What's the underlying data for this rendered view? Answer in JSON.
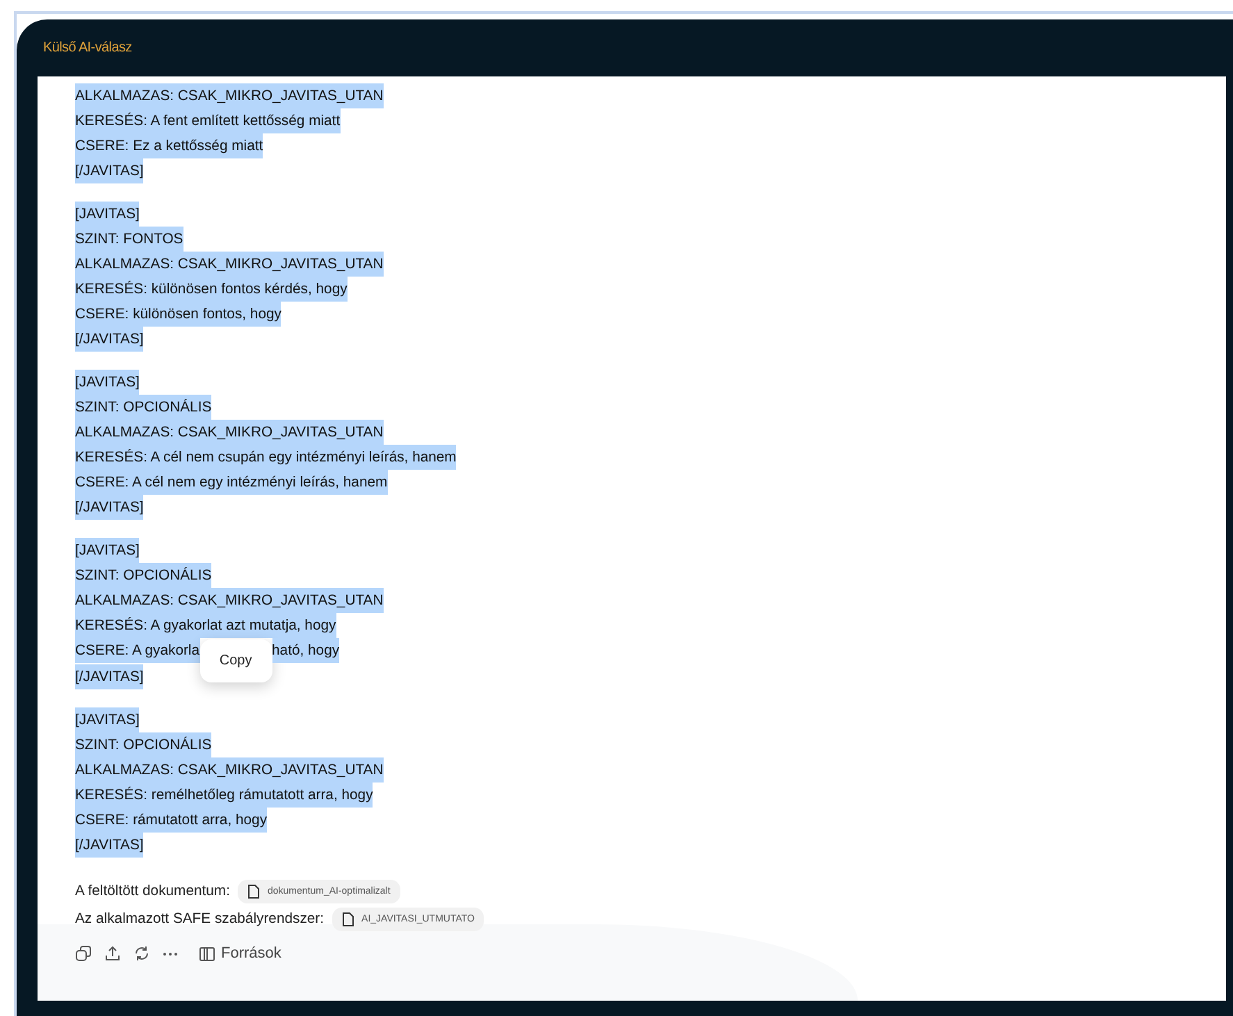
{
  "window": {
    "title": "Külső AI-válasz"
  },
  "blocks": [
    {
      "highlighted": true,
      "lines": [
        {
          "kind": "text",
          "text": "ALKALMAZAS: CSAK_MIKRO_JAVITAS_UTAN"
        },
        {
          "kind": "text",
          "text": "KERESÉS: A fent említett kettősség miatt"
        },
        {
          "kind": "text",
          "text": "CSERE: Ez a kettősség miatt"
        },
        {
          "kind": "text",
          "text": "[/JAVITAS]"
        }
      ]
    },
    {
      "highlighted": true,
      "lines": [
        {
          "kind": "text",
          "text": "[JAVITAS]"
        },
        {
          "kind": "text",
          "text": "SZINT: FONTOS"
        },
        {
          "kind": "text",
          "text": "ALKALMAZAS: CSAK_MIKRO_JAVITAS_UTAN"
        },
        {
          "kind": "text",
          "text": "KERESÉS: különösen fontos kérdés, hogy"
        },
        {
          "kind": "text",
          "text": "CSERE: különösen fontos, hogy"
        },
        {
          "kind": "text",
          "text": "[/JAVITAS]"
        }
      ]
    },
    {
      "highlighted": true,
      "lines": [
        {
          "kind": "text",
          "text": "[JAVITAS]"
        },
        {
          "kind": "text",
          "text": "SZINT: OPCIONÁLIS"
        },
        {
          "kind": "text",
          "text": "ALKALMAZAS: CSAK_MIKRO_JAVITAS_UTAN"
        },
        {
          "kind": "text",
          "text": "KERESÉS: A cél nem csupán egy intézményi leírás, hanem"
        },
        {
          "kind": "text",
          "text": "CSERE: A cél nem egy intézményi leírás, hanem"
        },
        {
          "kind": "text",
          "text": "[/JAVITAS]"
        }
      ]
    },
    {
      "highlighted": true,
      "lines": [
        {
          "kind": "text",
          "text": "[JAVITAS]"
        },
        {
          "kind": "text",
          "text": "SZINT: OPCIONÁLIS"
        },
        {
          "kind": "text",
          "text": "ALKALMAZAS: CSAK_MIKRO_JAVITAS_UTAN"
        },
        {
          "kind": "text",
          "text": "KERESÉS: A gyakorlat azt mutatja, hogy"
        },
        {
          "kind": "covered",
          "before": "CSERE: A gyakorla",
          "after": "ható, hogy",
          "popup": "Copy"
        },
        {
          "kind": "text",
          "text": "[/JAVITAS]"
        }
      ]
    },
    {
      "highlighted": true,
      "lines": [
        {
          "kind": "text",
          "text": "[JAVITAS]"
        },
        {
          "kind": "text",
          "text": "SZINT: OPCIONÁLIS"
        },
        {
          "kind": "text",
          "text": "ALKALMAZAS: CSAK_MIKRO_JAVITAS_UTAN"
        },
        {
          "kind": "text",
          "text": "KERESÉS: remélhetőleg rámutatott arra, hogy"
        },
        {
          "kind": "text",
          "text": "CSERE: rámutatott arra, hogy"
        },
        {
          "kind": "text",
          "text": "[/JAVITAS]"
        }
      ]
    }
  ],
  "attachments": [
    {
      "label": "A feltöltött dokumentum:",
      "file": "dokumentum_AI-optimalizalt"
    },
    {
      "label": "Az alkalmazott SAFE szabályrendszer:",
      "file": "AI_JAVITASI_UTMUTATO"
    }
  ],
  "actions": {
    "sources": "Források"
  }
}
